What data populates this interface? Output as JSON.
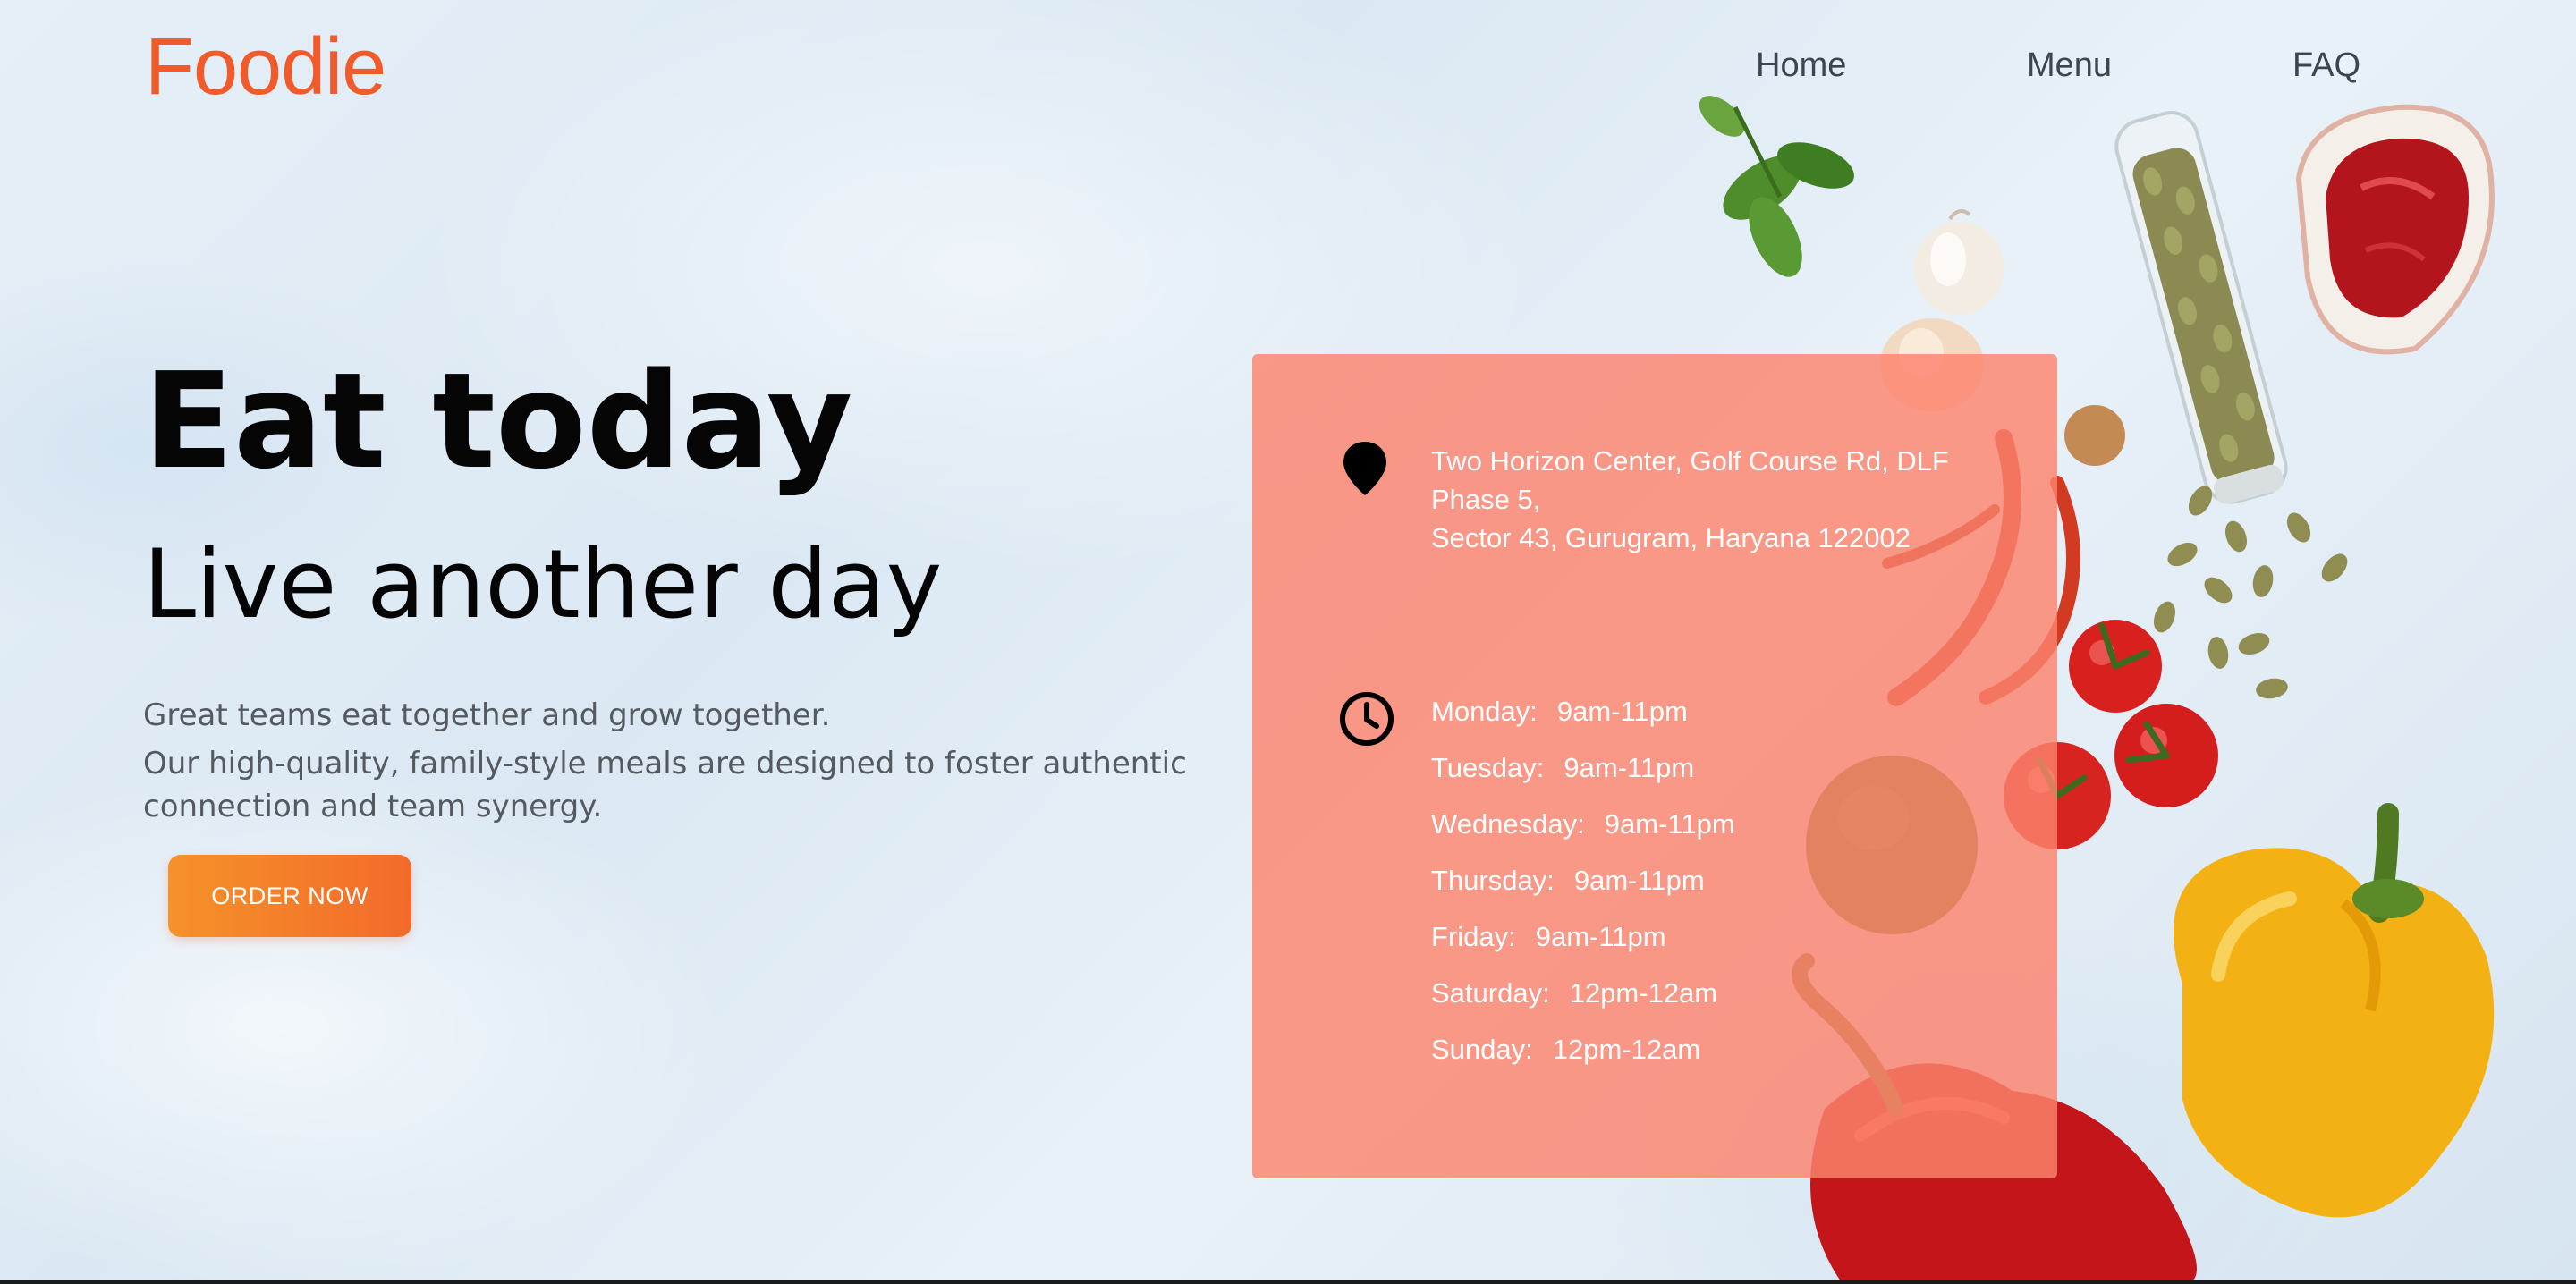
{
  "header": {
    "logo": "Foodie",
    "nav": [
      {
        "label": "Home"
      },
      {
        "label": "Menu"
      },
      {
        "label": "FAQ"
      }
    ]
  },
  "hero": {
    "title": "Eat today",
    "subtitle": "Live another day",
    "description_line1": "Great teams eat together and grow together.",
    "description_line2": "Our high-quality, family-style meals are designed to foster authentic connection and team synergy.",
    "cta_label": "ORDER NOW"
  },
  "info": {
    "address_lines": [
      "Two Horizon Center, Golf Course Rd, DLF",
      "Phase 5,",
      "Sector 43, Gurugram, Haryana 122002"
    ],
    "hours": [
      {
        "day": "Monday:",
        "time": "9am-11pm"
      },
      {
        "day": "Tuesday:",
        "time": "9am-11pm"
      },
      {
        "day": "Wednesday:",
        "time": "9am-11pm"
      },
      {
        "day": "Thursday:",
        "time": "9am-11pm"
      },
      {
        "day": "Friday:",
        "time": "9am-11pm"
      },
      {
        "day": "Saturday:",
        "time": "12pm-12am"
      },
      {
        "day": "Sunday:",
        "time": "12pm-12am"
      }
    ]
  },
  "colors": {
    "brand": "#f15a2b",
    "card": "#fc846e",
    "button_start": "#f5922a",
    "button_end": "#f36a2a"
  },
  "icons": [
    "location-pin-icon",
    "clock-icon"
  ]
}
